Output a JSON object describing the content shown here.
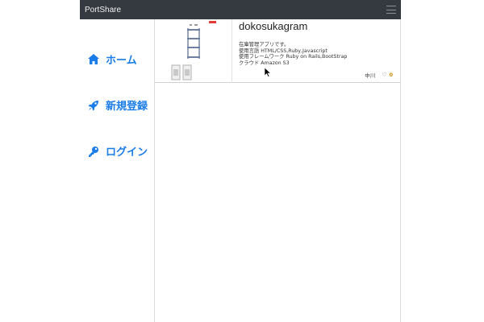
{
  "navbar": {
    "brand": "PortShare",
    "menu_icon": "hamburger-icon"
  },
  "sidebar": {
    "items": [
      {
        "label": "ホーム",
        "icon": "home-icon"
      },
      {
        "label": "新規登録",
        "icon": "rocket-icon"
      },
      {
        "label": "ログイン",
        "icon": "key-icon"
      }
    ]
  },
  "post": {
    "title": "dokosukagram",
    "description": [
      "在庫管理アプリです。",
      "使用言語 HTML/CSS,Ruby,Javascript",
      "使用フレームワーク Ruby on Rails,BootStrap",
      "クラウド Amazon S3"
    ],
    "author": "中川",
    "heart_icon": "heart-outline-icon",
    "likes": "0"
  },
  "colors": {
    "navbar": "#343a40",
    "link": "#1a7ce8",
    "likes": "#d08a00"
  }
}
